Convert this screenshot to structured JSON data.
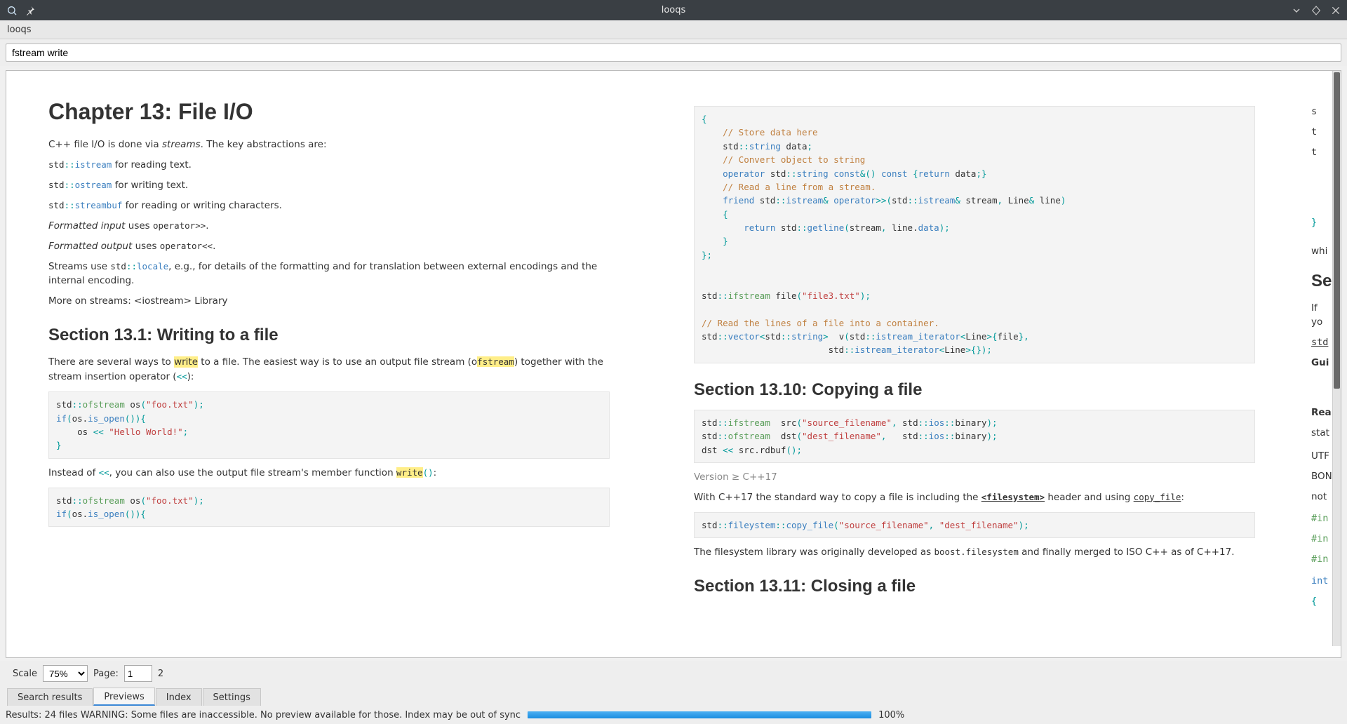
{
  "window": {
    "title": "looqs"
  },
  "menu": {
    "app": "looqs"
  },
  "search": {
    "value": "fstream write"
  },
  "controls": {
    "scale_label": "Scale",
    "scale_value": "75%",
    "page_label": "Page:",
    "page_value": "1",
    "page_total": "2"
  },
  "tabs": [
    {
      "id": "search-results",
      "label": "Search results",
      "active": false
    },
    {
      "id": "previews",
      "label": "Previews",
      "active": true
    },
    {
      "id": "index",
      "label": "Index",
      "active": false
    },
    {
      "id": "settings",
      "label": "Settings",
      "active": false
    }
  ],
  "status": {
    "text": "Results: 24 files WARNING: Some files are inaccessible. No preview available for those. Index may be out of sync",
    "progress_pct": "100%"
  },
  "card1": {
    "chapter_heading": "Chapter 13: File I/O",
    "p1_a": "C++ file I/O is done via ",
    "p1_b": "streams",
    "p1_c": ". The key abstractions are:",
    "li1_pre": "std",
    "li1_sep": "::",
    "li1_cls": "istream",
    "li1_txt": " for reading text.",
    "li2_pre": "std",
    "li2_sep": "::",
    "li2_cls": "ostream",
    "li2_txt": " for writing text.",
    "li3_pre": "std",
    "li3_sep": "::",
    "li3_cls": "streambuf",
    "li3_txt": " for reading or writing characters.",
    "fmt_in_a": "Formatted input",
    "fmt_in_b": " uses ",
    "fmt_in_c": "operator>>",
    "fmt_in_d": ".",
    "fmt_out_a": "Formatted output",
    "fmt_out_b": " uses ",
    "fmt_out_c": "operator<<",
    "fmt_out_d": ".",
    "streams_a": "Streams use ",
    "streams_b_pre": "std",
    "streams_b_sep": "::",
    "streams_b_cls": "locale",
    "streams_c": ", e.g., for details of the formatting and for translation between external encodings and the internal encoding.",
    "more": "More on streams: <iostream> Library",
    "sec131": "Section 13.1: Writing to a file",
    "s131_p1_a": "There are several ways to ",
    "s131_p1_b": "write",
    "s131_p1_c": " to a file. The easiest way is to use an output file stream (o",
    "s131_p1_d": "fstream",
    "s131_p1_e": ") together with the stream insertion operator (",
    "s131_p1_f": "<<",
    "s131_p1_g": "):",
    "s131_p2_a": "Instead of ",
    "s131_p2_b": "<<",
    "s131_p2_c": ", you can also use the output file stream's member function ",
    "s131_p2_d": "write",
    "s131_p2_e": "()",
    "s131_p2_f": ":"
  },
  "card2": {
    "sec1310": "Section 13.10: Copying a file",
    "ver": "Version ≥ C++17",
    "p1_a": "With C++17 the standard way to copy a file is including the ",
    "p1_b": "<filesystem>",
    "p1_c": " header and using ",
    "p1_d": "copy_file",
    "p1_e": ":",
    "p2_a": "The filesystem library was originally developed as ",
    "p2_b": "boost.filesystem",
    "p2_c": " and finally merged to ISO C++ as of C++17.",
    "sec1311": "Section 13.11: Closing a file"
  },
  "card3": {
    "frag1": "s",
    "frag2": "t",
    "frag3": "t",
    "frag4": "}",
    "frag5": "whi",
    "sec_head": "Se",
    "if_you": "If yo",
    "std_u": "std",
    "gui": "Gui",
    "rea": "Rea",
    "stat": "stat",
    "utf": "UTF",
    "bom": "BON",
    "not": "not",
    "inc": "#in",
    "int": "int"
  }
}
